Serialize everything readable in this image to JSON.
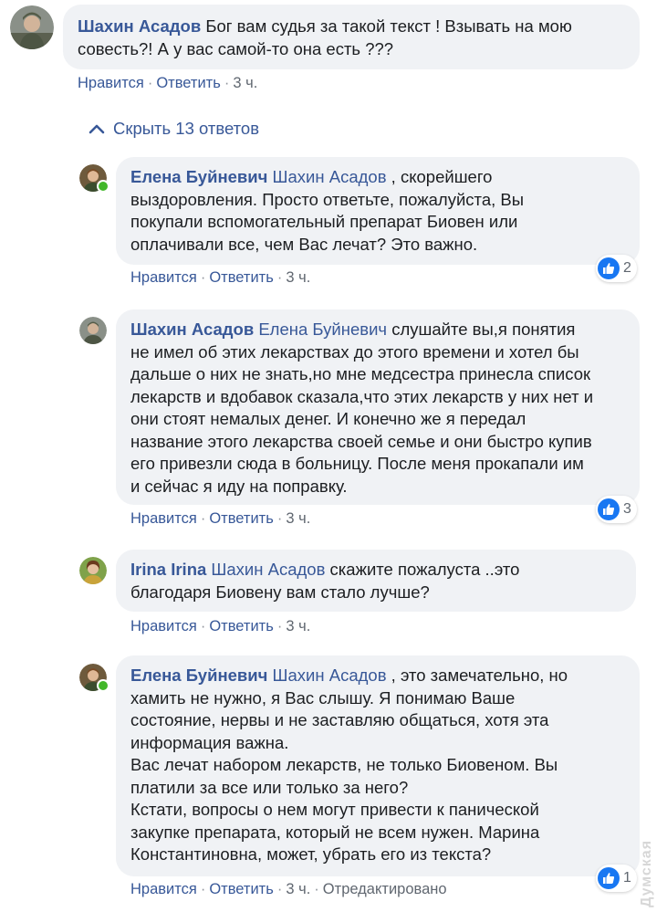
{
  "actions": {
    "like": "Нравится",
    "reply": "Ответить",
    "separator": "·"
  },
  "hide_replies_label": "Скрыть 13 ответов",
  "comments": [
    {
      "author": "Шахин Асадов",
      "lines": [
        "Бог вам судья за такой текст ! Взывать на мою",
        "совесть?! А у вас самой-то она есть ???"
      ],
      "time": "3 ч."
    },
    {
      "author": "Елена Буйневич",
      "mention": "Шахин Асадов",
      "lines": [
        ", скорейшего",
        "выздоровления. Просто ответьте, пожалуйста, Вы",
        "покупали вспомогательный препарат Биовен или",
        "оплачивали все, чем Вас лечат? Это важно."
      ],
      "time": "3 ч.",
      "reactions": "2"
    },
    {
      "author": "Шахин Асадов",
      "mention": "Елена Буйневич",
      "lines": [
        "слушайте вы,я понятия",
        "не имел об этих лекарствах до этого времени и хотел бы",
        "дальше о них не знать,но мне медсестра принесла список",
        "лекарств и вдобавок сказала,что этих лекарств у них нет и",
        "они стоят немалых денег. И конечно же я передал",
        "название этого лекарства своей семье и они быстро купив",
        "его привезли сюда в больницу. После меня прокапали им",
        "и сейчас я иду на поправку."
      ],
      "time": "3 ч.",
      "reactions": "3"
    },
    {
      "author": "Irina Irina",
      "mention": "Шахин Асадов",
      "lines": [
        "скажите пожалуста ..это",
        "благодаря Биовену вам стало лучше?"
      ],
      "time": "3 ч."
    },
    {
      "author": "Елена Буйневич",
      "mention": "Шахин Асадов",
      "lines": [
        ", это замечательно, но",
        "хамить не нужно, я Вас слышу. Я понимаю Ваше",
        "состояние, нервы и не заставляю общаться, хотя эта",
        "информация важна.",
        "Вас лечат набором лекарств, не только Биовеном. Вы",
        "платили за все или только за него?",
        "Кстати, вопросы о нем могут привести к панической",
        "закупке препарата, который не всем нужен. Марина",
        "Константиновна, может, убрать его из текста?"
      ],
      "time": "3 ч.",
      "edited": "Отредактировано",
      "reactions": "1"
    }
  ],
  "watermark": "Думская",
  "colors": {
    "link": "#385898",
    "bubble": "#f0f2f5",
    "online": "#42b72a",
    "like": "#1877f2"
  }
}
